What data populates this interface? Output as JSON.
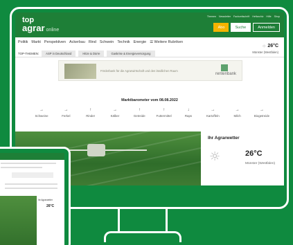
{
  "colors": {
    "background": "#0f8a3f",
    "header": "#1e7f37",
    "abo_button": "#f5b400"
  },
  "header": {
    "logo_top": "top",
    "logo_bottom": "agrar",
    "logo_suffix": "online",
    "top_links": [
      "Themen",
      "Newsletter",
      "Fachzeitschrift",
      "Heftarchiv",
      "Hilfe",
      "Shop"
    ],
    "buttons": {
      "abo": "Abo",
      "search": "Suche",
      "login": "Anmelden"
    }
  },
  "nav": {
    "items": [
      "Politik",
      "Markt",
      "Perspektiven",
      "Ackerbau",
      "Rind",
      "Schwein",
      "Technik",
      "Energie",
      "☰ Weitere Rubriken"
    ]
  },
  "weather_mini": {
    "temp": "26°C",
    "location": "Münster (Westfalen)",
    "icon": "sun-icon"
  },
  "top_themen": {
    "label": "TOP-THEMEN:",
    "chips": [
      "ASP in Deutschland",
      "Hitze & Dürre",
      "Gaskrise & Energieversorgung"
    ]
  },
  "banner": {
    "text": "Förderbank für die Agrarwirtschaft und den ländlichen Raum",
    "brand": "rentenbank"
  },
  "marktbarometer": {
    "title": "Marktbarometer vom 08.08.2022",
    "items": [
      {
        "arrow": "→",
        "name": "Schweine"
      },
      {
        "arrow": "→",
        "name": "Ferkel"
      },
      {
        "arrow": "↑",
        "name": "Rinder"
      },
      {
        "arrow": "→",
        "name": "Kälber"
      },
      {
        "arrow": "↑",
        "name": "Getreide"
      },
      {
        "arrow": "↑",
        "name": "Futtermittel"
      },
      {
        "arrow": "↓",
        "name": "Raps"
      },
      {
        "arrow": "→",
        "name": "Kartoffeln"
      },
      {
        "arrow": "→",
        "name": "Milch"
      },
      {
        "arrow": "→",
        "name": "Biogetreide"
      }
    ]
  },
  "agrarwetter": {
    "title": "Ihr Agrarwetter",
    "temp": "26°C",
    "location": "Münster (Westfalen)",
    "icon": "sun-icon"
  },
  "tablet": {
    "weather_title": "Ihr Agrarwetter",
    "temp": "26°C"
  }
}
